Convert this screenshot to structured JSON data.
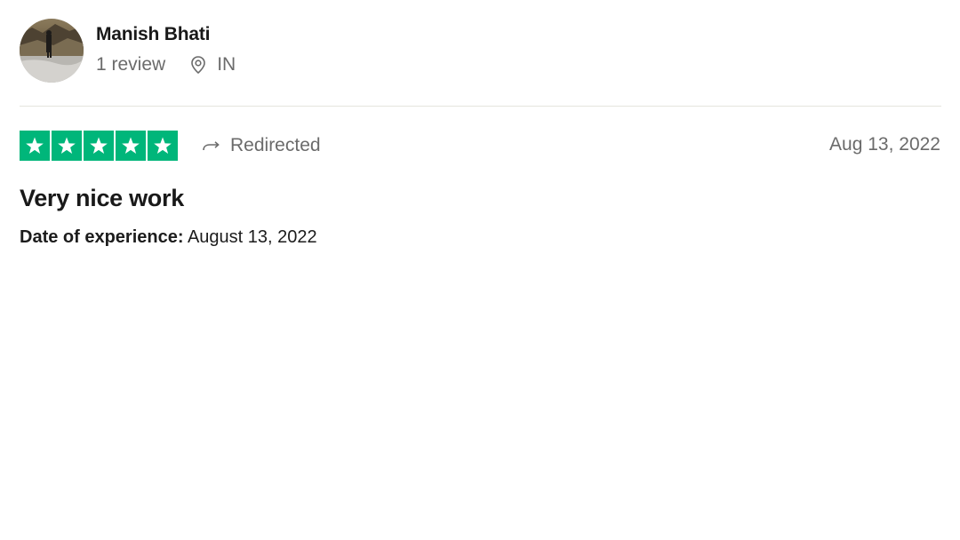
{
  "reviewer": {
    "name": "Manish Bhati",
    "review_count": "1 review",
    "country": "IN"
  },
  "rating": {
    "stars": 5,
    "max_stars": 5,
    "star_color": "#00b67a",
    "redirect_label": "Redirected"
  },
  "review": {
    "date": "Aug 13, 2022",
    "title": "Very nice work",
    "experience_label": "Date of experience:",
    "experience_date": "August 13, 2022"
  },
  "icons": {
    "location": "map-pin-icon",
    "redirect": "redirect-arrow-icon",
    "star": "star-icon"
  }
}
